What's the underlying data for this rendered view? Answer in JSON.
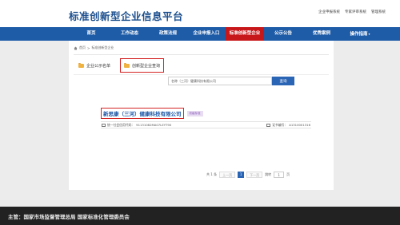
{
  "header": {
    "site_title": "标准创新型企业信息平台",
    "top_links": [
      "企业申报系统",
      "专家评审系统",
      "管理系统"
    ]
  },
  "nav": {
    "items": [
      {
        "label": "首页",
        "active": false
      },
      {
        "label": "工作动态",
        "active": false
      },
      {
        "label": "政策法规",
        "active": false
      },
      {
        "label": "企业申报入口",
        "active": false
      },
      {
        "label": "标准创新型企业",
        "active": true
      },
      {
        "label": "公示公告",
        "active": false
      },
      {
        "label": "优秀案例",
        "active": false
      },
      {
        "label": "操作指南",
        "active": false,
        "has_dropdown": true
      }
    ]
  },
  "breadcrumb": {
    "home": "首页",
    "separator": ">",
    "current": "标准创新型企业"
  },
  "tabs": [
    {
      "label": "企业公示名单",
      "active": false
    },
    {
      "label": "创新型企业查询",
      "active": true
    }
  ],
  "search": {
    "value": "名称（三河）健康科技有限公司",
    "button": "查询"
  },
  "result": {
    "company_name": "新思康（三河）健康科技有限公司",
    "tag": "初级标准",
    "credit_code_label": "统一社会信用代码：",
    "credit_code": "91131082MA07LEYT90",
    "cert_label": "证书编号：",
    "cert_no": "A1310001316"
  },
  "pager": {
    "total": "共 1 条",
    "prev": "上一页",
    "current": "1",
    "next": "下一页",
    "goto": "跳转",
    "goto_value": "1",
    "page_unit": "页"
  },
  "footer": {
    "text": "主管：国家市场监督管理总局 国家标准化管理委员会"
  },
  "colors": {
    "nav_bg": "#1f5ca8",
    "nav_active": "#c8171b",
    "title": "#1c4f8e",
    "highlight_border": "#d42424",
    "footer_bg": "#222222"
  },
  "icons": [
    "home-icon",
    "folder-icon",
    "id-card-icon",
    "dropdown-icon"
  ]
}
